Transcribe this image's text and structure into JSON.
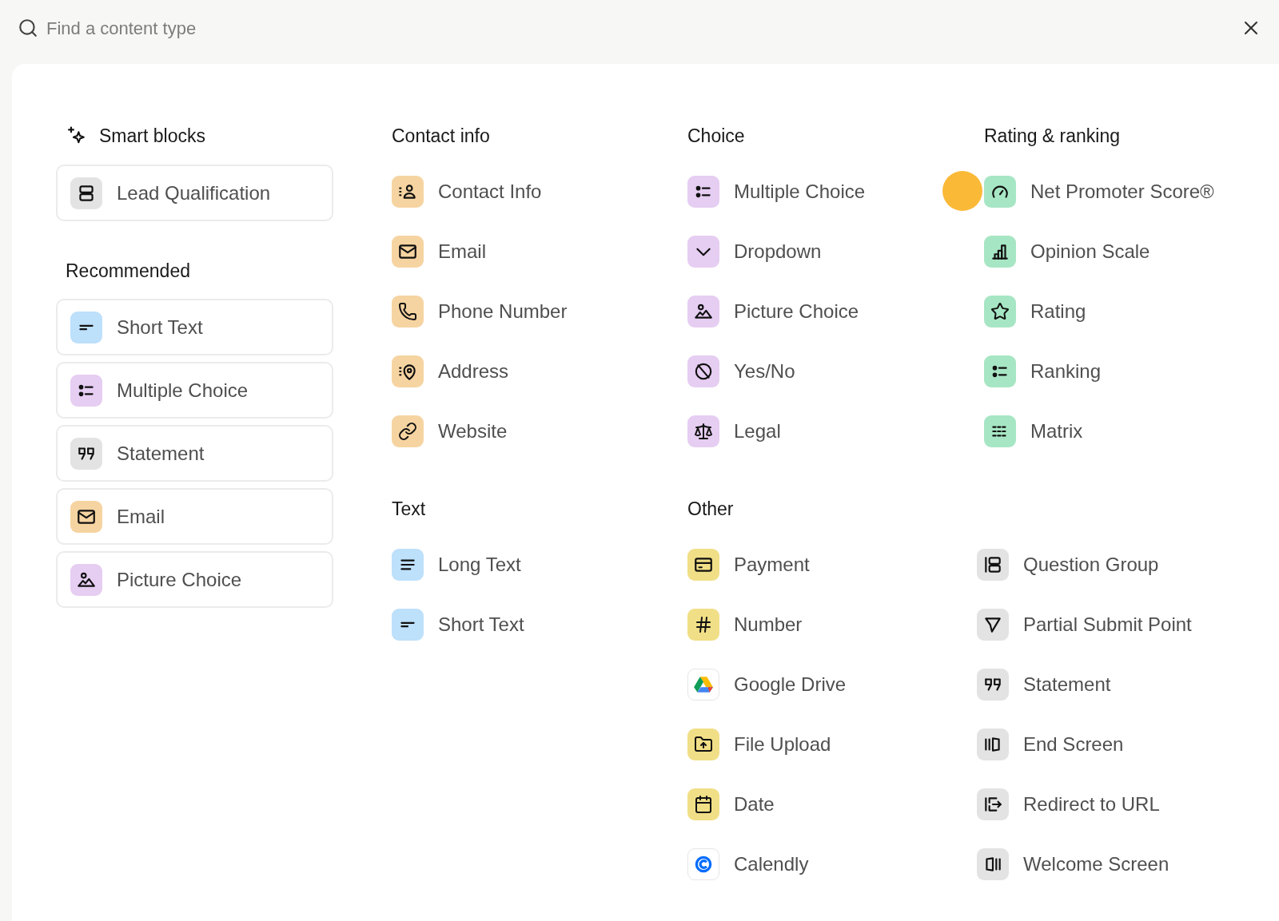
{
  "search": {
    "placeholder": "Find a content type"
  },
  "smart_blocks": {
    "title": "Smart blocks",
    "items": [
      {
        "label": "Lead Qualification",
        "kind": "lead_qualification",
        "color": "#e3e3e3"
      }
    ]
  },
  "recommended": {
    "title": "Recommended",
    "items": [
      {
        "label": "Short Text",
        "kind": "short_text",
        "color": "#bde0fb"
      },
      {
        "label": "Multiple Choice",
        "kind": "multiple_choice",
        "color": "#e6cdf2"
      },
      {
        "label": "Statement",
        "kind": "statement",
        "color": "#e3e3e3"
      },
      {
        "label": "Email",
        "kind": "email",
        "color": "#f6d4a1"
      },
      {
        "label": "Picture Choice",
        "kind": "picture_choice",
        "color": "#e6cdf2"
      }
    ]
  },
  "contact_info": {
    "title": "Contact info",
    "items": [
      {
        "label": "Contact Info",
        "kind": "contact_info",
        "color": "#f6d4a1"
      },
      {
        "label": "Email",
        "kind": "email",
        "color": "#f6d4a1"
      },
      {
        "label": "Phone Number",
        "kind": "phone",
        "color": "#f6d4a1"
      },
      {
        "label": "Address",
        "kind": "address",
        "color": "#f6d4a1"
      },
      {
        "label": "Website",
        "kind": "website",
        "color": "#f6d4a1"
      }
    ]
  },
  "choice": {
    "title": "Choice",
    "items": [
      {
        "label": "Multiple Choice",
        "kind": "multiple_choice",
        "color": "#e6cdf2"
      },
      {
        "label": "Dropdown",
        "kind": "dropdown",
        "color": "#e6cdf2"
      },
      {
        "label": "Picture Choice",
        "kind": "picture_choice",
        "color": "#e6cdf2"
      },
      {
        "label": "Yes/No",
        "kind": "yes_no",
        "color": "#e6cdf2"
      },
      {
        "label": "Legal",
        "kind": "legal",
        "color": "#e6cdf2"
      }
    ]
  },
  "rating_ranking": {
    "title": "Rating & ranking",
    "items": [
      {
        "label": "Net Promoter Score®",
        "kind": "nps",
        "color": "#a7e6c4"
      },
      {
        "label": "Opinion Scale",
        "kind": "opinion_scale",
        "color": "#a7e6c4"
      },
      {
        "label": "Rating",
        "kind": "rating",
        "color": "#a7e6c4"
      },
      {
        "label": "Ranking",
        "kind": "ranking",
        "color": "#a7e6c4"
      },
      {
        "label": "Matrix",
        "kind": "matrix",
        "color": "#a7e6c4"
      }
    ]
  },
  "text": {
    "title": "Text",
    "items": [
      {
        "label": "Long Text",
        "kind": "long_text",
        "color": "#bde0fb"
      },
      {
        "label": "Short Text",
        "kind": "short_text",
        "color": "#bde0fb"
      }
    ]
  },
  "other": {
    "title": "Other",
    "items": [
      {
        "label": "Payment",
        "kind": "payment",
        "color": "#f1df87"
      },
      {
        "label": "Number",
        "kind": "number",
        "color": "#f1df87"
      },
      {
        "label": "Google Drive",
        "kind": "google_drive",
        "color": "#ffffff"
      },
      {
        "label": "File Upload",
        "kind": "file_upload",
        "color": "#f1df87"
      },
      {
        "label": "Date",
        "kind": "date",
        "color": "#f1df87"
      },
      {
        "label": "Calendly",
        "kind": "calendly",
        "color": "#ffffff"
      },
      {
        "label": "Question Group",
        "kind": "question_group",
        "color": "#e3e3e3"
      },
      {
        "label": "Partial Submit Point",
        "kind": "partial_submit",
        "color": "#e3e3e3"
      },
      {
        "label": "Statement",
        "kind": "statement",
        "color": "#e3e3e3"
      },
      {
        "label": "End Screen",
        "kind": "end_screen",
        "color": "#e3e3e3"
      },
      {
        "label": "Redirect to URL",
        "kind": "redirect",
        "color": "#e3e3e3"
      },
      {
        "label": "Welcome Screen",
        "kind": "welcome_screen",
        "color": "#e3e3e3"
      }
    ]
  },
  "cursor_highlight": true
}
